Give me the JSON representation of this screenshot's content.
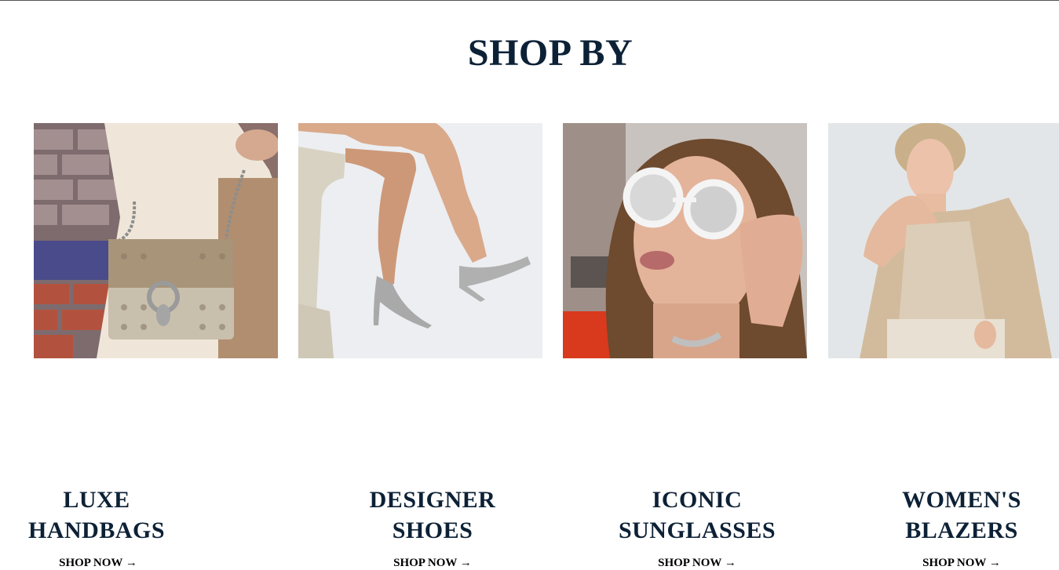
{
  "section": {
    "title": "SHOP BY"
  },
  "categories": [
    {
      "title": "LUXE\nHANDBAGS",
      "link": "SHOP NOW →",
      "image_alt": "Beige monogram shoulder bag with chain strap"
    },
    {
      "title": "DESIGNER\nSHOES",
      "link": "SHOP NOW →",
      "image_alt": "Silver metallic stiletto pumps"
    },
    {
      "title": "ICONIC\nSUNGLASSES",
      "link": "SHOP NOW →",
      "image_alt": "Woman wearing white cat-eye mirrored sunglasses"
    },
    {
      "title": "WOMEN'S\nBLAZERS",
      "link": "SHOP NOW →",
      "image_alt": "Woman in beige blazer and knit top"
    }
  ],
  "colors": {
    "heading": "#0d2136",
    "link": "#000000"
  }
}
